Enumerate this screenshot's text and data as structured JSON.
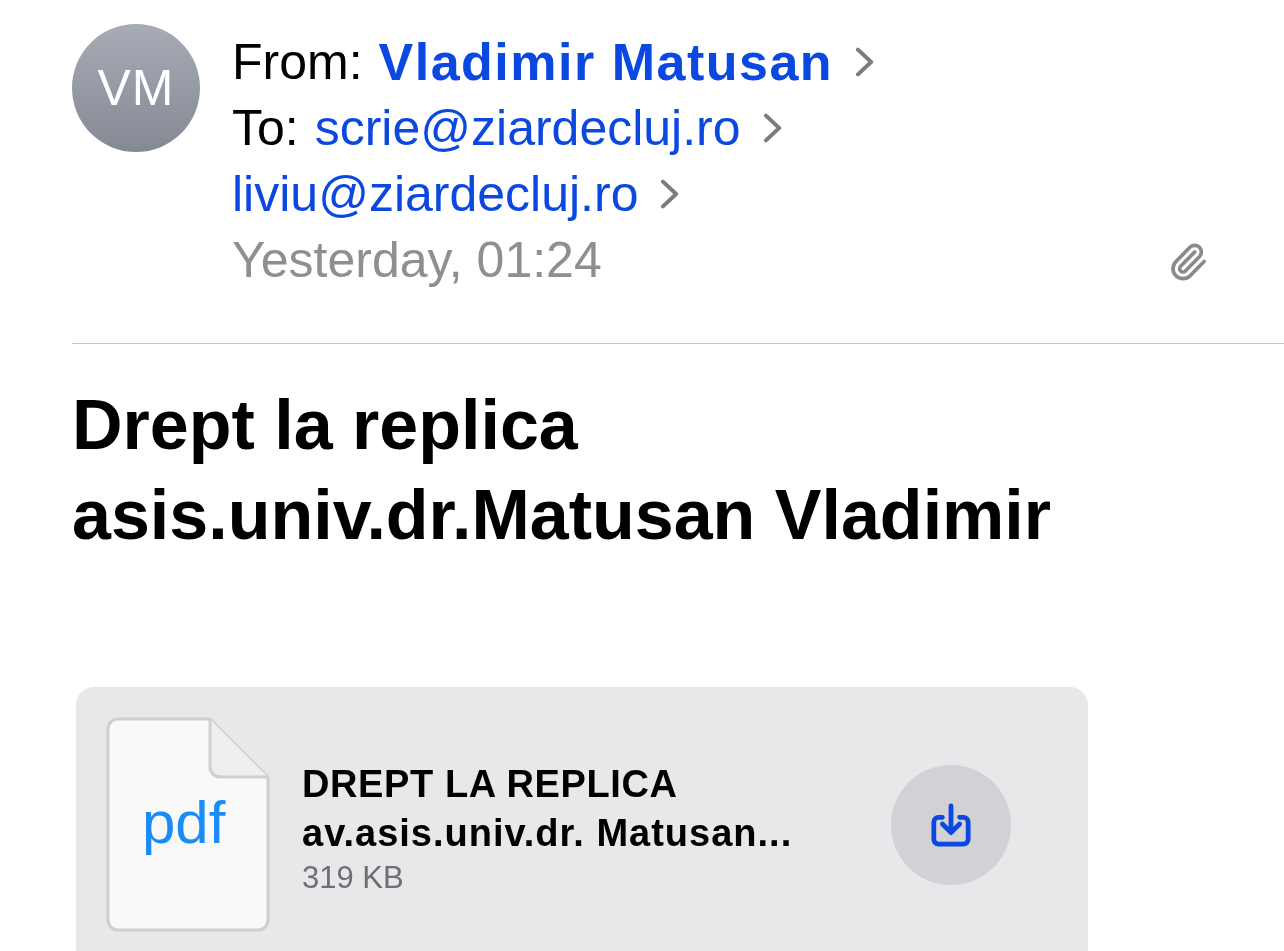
{
  "header": {
    "avatar": {
      "initials": "VM"
    },
    "from": {
      "label": "From:",
      "name": "Vladimir Matusan"
    },
    "to": {
      "label": "To:",
      "recipients": [
        "scrie@ziardecluj.ro",
        "liviu@ziardecluj.ro"
      ]
    },
    "date": "Yesterday, 01:24",
    "has_attachment": true
  },
  "subject": "Drept la replica asis.univ.dr.Matusan Vladimir",
  "attachment": {
    "type_label": "pdf",
    "title": "DREPT LA REPLICA",
    "name": "av.asis.univ.dr. Matusan...",
    "size": "319 KB"
  }
}
